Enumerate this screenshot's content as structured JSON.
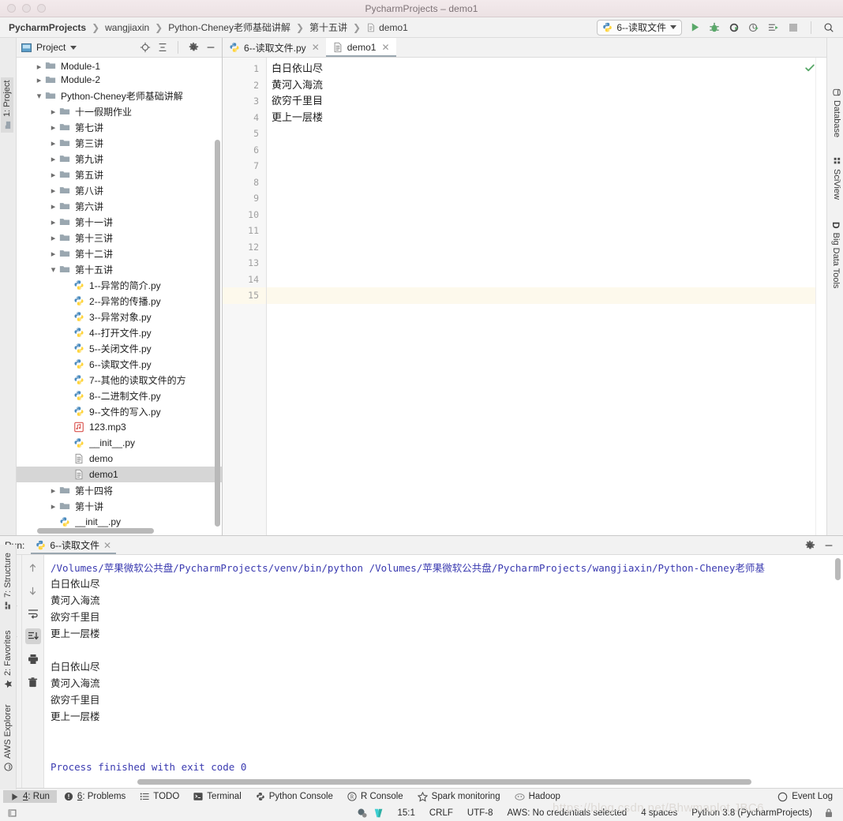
{
  "window": {
    "title": "PycharmProjects – demo1"
  },
  "breadcrumbs": [
    {
      "label": "PycharmProjects",
      "bold": true,
      "icon": ""
    },
    {
      "label": "wangjiaxin",
      "bold": false,
      "icon": ""
    },
    {
      "label": "Python-Cheney老师基础讲解",
      "bold": false,
      "icon": ""
    },
    {
      "label": "第十五讲",
      "bold": false,
      "icon": ""
    },
    {
      "label": "demo1",
      "bold": false,
      "icon": "file-icon"
    }
  ],
  "toolbar": {
    "run_config_label": "6--读取文件",
    "run_config_icon": "python-icon",
    "dropdown_icon": "chevron-down-icon",
    "buttons": [
      {
        "name": "run-button",
        "icon": "play-icon"
      },
      {
        "name": "debug-button",
        "icon": "bug-icon"
      },
      {
        "name": "run-coverage-button",
        "icon": "coverage-icon"
      },
      {
        "name": "profile-button",
        "icon": "profile-icon"
      },
      {
        "name": "run-with-console-button",
        "icon": "console-run-icon"
      },
      {
        "name": "stop-button",
        "icon": "stop-icon"
      },
      {
        "name": "search-everywhere-button",
        "icon": "search-icon"
      }
    ]
  },
  "left_rail": [
    {
      "label": "1: Project",
      "icon": "project-icon",
      "selected": true
    }
  ],
  "left_rail_bottom": [
    {
      "label": "7: Structure",
      "icon": "structure-icon"
    },
    {
      "label": "2: Favorites",
      "icon": "star-icon"
    },
    {
      "label": "AWS Explorer",
      "icon": "aws-icon"
    }
  ],
  "right_rail": [
    {
      "label": "Database",
      "icon": "database-icon"
    },
    {
      "label": "SciView",
      "icon": "sciview-icon"
    },
    {
      "label": "Big Data Tools",
      "icon": "bigdata-icon"
    }
  ],
  "project_panel": {
    "title": "Project",
    "dropdown_icon": "chevron-down-icon",
    "panel_icon": "project-window-icon",
    "actions": [
      {
        "name": "select-opened-file-button",
        "icon": "target-icon"
      },
      {
        "name": "collapse-all-button",
        "icon": "collapse-icon"
      },
      {
        "name": "settings-button",
        "icon": "gear-icon"
      },
      {
        "name": "hide-button",
        "icon": "minus-icon"
      }
    ],
    "tree": [
      {
        "label": "Module-1",
        "indent": 1,
        "arrow": "right",
        "icon": "folder-icon",
        "clipped": true
      },
      {
        "label": "Module-2",
        "indent": 1,
        "arrow": "right",
        "icon": "folder-icon"
      },
      {
        "label": "Python-Cheney老师基础讲解",
        "indent": 1,
        "arrow": "down",
        "icon": "folder-icon"
      },
      {
        "label": "十一假期作业",
        "indent": 2,
        "arrow": "right",
        "icon": "folder-icon"
      },
      {
        "label": "第七讲",
        "indent": 2,
        "arrow": "right",
        "icon": "folder-icon"
      },
      {
        "label": "第三讲",
        "indent": 2,
        "arrow": "right",
        "icon": "folder-icon"
      },
      {
        "label": "第九讲",
        "indent": 2,
        "arrow": "right",
        "icon": "folder-icon"
      },
      {
        "label": "第五讲",
        "indent": 2,
        "arrow": "right",
        "icon": "folder-icon"
      },
      {
        "label": "第八讲",
        "indent": 2,
        "arrow": "right",
        "icon": "folder-icon"
      },
      {
        "label": "第六讲",
        "indent": 2,
        "arrow": "right",
        "icon": "folder-icon"
      },
      {
        "label": "第十一讲",
        "indent": 2,
        "arrow": "right",
        "icon": "folder-icon"
      },
      {
        "label": "第十三讲",
        "indent": 2,
        "arrow": "right",
        "icon": "folder-icon"
      },
      {
        "label": "第十二讲",
        "indent": 2,
        "arrow": "right",
        "icon": "folder-icon"
      },
      {
        "label": "第十五讲",
        "indent": 2,
        "arrow": "down",
        "icon": "folder-icon"
      },
      {
        "label": "1--异常的简介.py",
        "indent": 3,
        "arrow": "none",
        "icon": "python-file-icon"
      },
      {
        "label": "2--异常的传播.py",
        "indent": 3,
        "arrow": "none",
        "icon": "python-file-icon"
      },
      {
        "label": "3--异常对象.py",
        "indent": 3,
        "arrow": "none",
        "icon": "python-file-icon"
      },
      {
        "label": "4--打开文件.py",
        "indent": 3,
        "arrow": "none",
        "icon": "python-file-icon"
      },
      {
        "label": "5--关闭文件.py",
        "indent": 3,
        "arrow": "none",
        "icon": "python-file-icon"
      },
      {
        "label": "6--读取文件.py",
        "indent": 3,
        "arrow": "none",
        "icon": "python-file-icon"
      },
      {
        "label": "7--其他的读取文件的方",
        "indent": 3,
        "arrow": "none",
        "icon": "python-file-icon",
        "clipped": true
      },
      {
        "label": "8--二进制文件.py",
        "indent": 3,
        "arrow": "none",
        "icon": "python-file-icon"
      },
      {
        "label": "9--文件的写入.py",
        "indent": 3,
        "arrow": "none",
        "icon": "python-file-icon"
      },
      {
        "label": "123.mp3",
        "indent": 3,
        "arrow": "none",
        "icon": "audio-file-icon"
      },
      {
        "label": "__init__.py",
        "indent": 3,
        "arrow": "none",
        "icon": "python-file-icon"
      },
      {
        "label": "demo",
        "indent": 3,
        "arrow": "none",
        "icon": "text-file-icon"
      },
      {
        "label": "demo1",
        "indent": 3,
        "arrow": "none",
        "icon": "text-file-icon",
        "selected": true
      },
      {
        "label": "第十四将",
        "indent": 2,
        "arrow": "right",
        "icon": "folder-icon"
      },
      {
        "label": "第十讲",
        "indent": 2,
        "arrow": "right",
        "icon": "folder-icon"
      },
      {
        "label": "__init__.py",
        "indent": 2,
        "arrow": "none",
        "icon": "python-file-icon"
      }
    ]
  },
  "editor": {
    "tabs": [
      {
        "label": "6--读取文件.py",
        "icon": "python-file-icon",
        "active": false,
        "close_icon": "close-icon"
      },
      {
        "label": "demo1",
        "icon": "text-file-icon",
        "active": true,
        "close_icon": "close-icon"
      }
    ],
    "inspection_icon": "checkmark-icon",
    "lines": [
      {
        "n": "1",
        "text": "白日依山尽"
      },
      {
        "n": "2",
        "text": "黄河入海流"
      },
      {
        "n": "3",
        "text": "欲穷千里目"
      },
      {
        "n": "4",
        "text": "更上一层楼"
      },
      {
        "n": "5",
        "text": ""
      },
      {
        "n": "6",
        "text": ""
      },
      {
        "n": "7",
        "text": ""
      },
      {
        "n": "8",
        "text": ""
      },
      {
        "n": "9",
        "text": ""
      },
      {
        "n": "10",
        "text": ""
      },
      {
        "n": "11",
        "text": ""
      },
      {
        "n": "12",
        "text": ""
      },
      {
        "n": "13",
        "text": ""
      },
      {
        "n": "14",
        "text": ""
      },
      {
        "n": "15",
        "text": "",
        "current": true
      }
    ]
  },
  "run_panel": {
    "label": "Run:",
    "tab_label": "6--读取文件",
    "tab_icon": "python-icon",
    "tab_close_icon": "close-icon",
    "settings_icon": "gear-icon",
    "hide_icon": "minus-icon",
    "toolbar_left": [
      {
        "name": "rerun-button",
        "icon": "play-icon"
      },
      {
        "name": "stop-button",
        "icon": "stop-icon"
      },
      {
        "name": "restore-layout-button",
        "icon": "layout-icon"
      },
      {
        "name": "pin-tab-button",
        "icon": "pin-icon"
      }
    ],
    "toolbar_right": [
      {
        "name": "up-stacktrace-button",
        "icon": "arrow-up-icon"
      },
      {
        "name": "down-stacktrace-button",
        "icon": "arrow-down-icon"
      },
      {
        "name": "soft-wrap-button",
        "icon": "wrap-icon"
      },
      {
        "name": "scroll-to-end-button",
        "icon": "scroll-end-icon",
        "active": true
      },
      {
        "name": "print-button",
        "icon": "print-icon"
      },
      {
        "name": "clear-all-button",
        "icon": "trash-icon"
      }
    ],
    "console": [
      {
        "text": "/Volumes/苹果微软公共盘/PycharmProjects/venv/bin/python /Volumes/苹果微软公共盘/PycharmProjects/wangjiaxin/Python-Cheney老师基",
        "style": "blue"
      },
      {
        "text": "白日依山尽",
        "style": "cjk"
      },
      {
        "text": "黄河入海流",
        "style": "cjk"
      },
      {
        "text": "欲穷千里目",
        "style": "cjk"
      },
      {
        "text": "更上一层楼",
        "style": "cjk"
      },
      {
        "text": "",
        "style": "plain"
      },
      {
        "text": "白日依山尽",
        "style": "cjk"
      },
      {
        "text": "黄河入海流",
        "style": "cjk"
      },
      {
        "text": "欲穷千里目",
        "style": "cjk"
      },
      {
        "text": "更上一层楼",
        "style": "cjk"
      },
      {
        "text": "",
        "style": "plain"
      },
      {
        "text": "",
        "style": "plain"
      },
      {
        "text": "Process finished with exit code 0",
        "style": "blue"
      }
    ]
  },
  "bottom_bar": [
    {
      "label": "4: Run",
      "mnemonic": "4",
      "icon": "play-icon",
      "selected": true
    },
    {
      "label": "6: Problems",
      "mnemonic": "6",
      "icon": "problems-icon",
      "selected": false
    },
    {
      "label": "TODO",
      "icon": "todo-icon",
      "selected": false
    },
    {
      "label": "Terminal",
      "icon": "terminal-icon",
      "selected": false
    },
    {
      "label": "Python Console",
      "icon": "python-icon",
      "selected": false
    },
    {
      "label": "R Console",
      "icon": "r-icon",
      "selected": false
    },
    {
      "label": "Spark monitoring",
      "icon": "spark-icon",
      "selected": false
    },
    {
      "label": "Hadoop",
      "icon": "hadoop-icon",
      "selected": false
    },
    {
      "label": "Event Log",
      "icon": "event-log-icon",
      "selected": false
    }
  ],
  "status_bar": {
    "left_icon": "toggle-toolbar-icon",
    "inspection_icon": "inspection-icon",
    "vcs_icon": "vcs-icon",
    "items": [
      "15:1",
      "CRLF",
      "UTF-8",
      "AWS: No credentials selected",
      "4 spaces",
      "Python 3.8 (PycharmProjects)"
    ],
    "lock_icon": "lock-icon",
    "watermark": "https://blog.csdn.net/Bhwmaplot    JBC6"
  }
}
